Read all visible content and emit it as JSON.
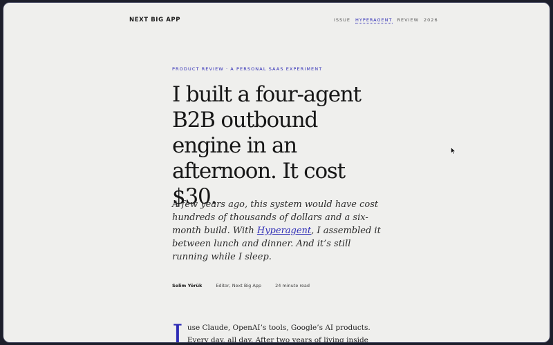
{
  "header": {
    "brand": "NEXT BIG APP",
    "nav": [
      "ISSUE",
      "HYPERAGENT",
      "REVIEW",
      "2026"
    ]
  },
  "article": {
    "kicker": "PRODUCT REVIEW · A PERSONAL SAAS EXPERIMENT",
    "headline": "I built a four-agent B2B outbound engine in an afternoon. It cost $30.",
    "dek": {
      "before": "A few years ago, this system would have cost hundreds of thousands of dollars and a six-month build. With ",
      "link": "Hyperagent",
      "after": ", I assembled it between lunch and dinner. And it’s still running while I sleep."
    },
    "byline": {
      "author": "Selim Yörük",
      "role": "Editor, Next Big App",
      "read_time": "24 minute read"
    },
    "body": {
      "dropcap": "I",
      "text": "use Claude, OpenAI’s tools, Google’s AI products. Every day, all day. After two years of living inside these systems, I"
    }
  },
  "colors": {
    "accent": "#2d2bb5",
    "background": "#efefed",
    "text": "#161616"
  },
  "icons": {
    "cursor": "mouse-pointer-icon"
  }
}
